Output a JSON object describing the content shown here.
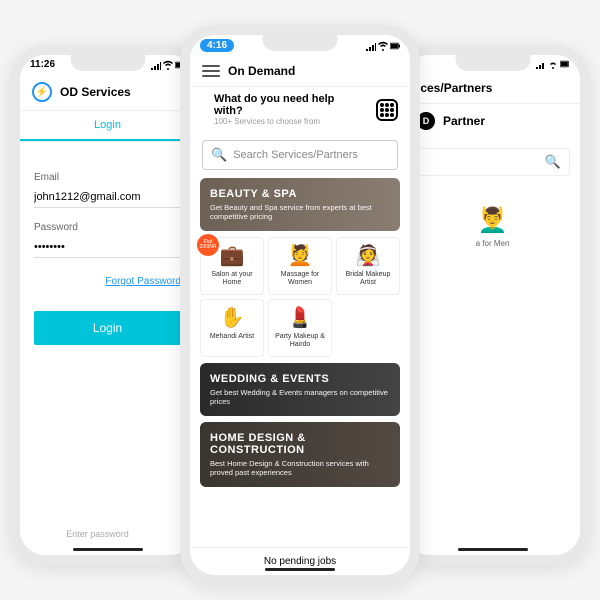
{
  "phoneLeft": {
    "time": "11:26",
    "appName": "OD Services",
    "tabs": {
      "login": "Login"
    },
    "email": {
      "label": "Email",
      "value": "john1212@gmail.com"
    },
    "password": {
      "label": "Password",
      "value": "••••••••"
    },
    "forgot": "Forgot Password",
    "loginBtn": "Login",
    "hint": "Enter password"
  },
  "phoneCenter": {
    "time": "4:16",
    "title": "On Demand",
    "subtitle": "What do you need help with?",
    "subtext": "100+ Services to choose from",
    "searchPlaceholder": "Search Services/Partners",
    "banners": {
      "beauty": {
        "title": "BEAUTY & SPA",
        "desc": "Get Beauty and Spa service from experts at best competitive pricing"
      },
      "wedding": {
        "title": "WEDDING & EVENTS",
        "desc": "Get best Wedding & Events managers on competitive prices"
      },
      "home": {
        "title": "HOME DESIGN & CONSTRUCTION",
        "desc": "Best Home Design & Construction services with proved past experiences"
      }
    },
    "badge": "Flat 200INR",
    "services": [
      {
        "label": "Salon at your Home",
        "icon": "💼"
      },
      {
        "label": "Massage for Women",
        "icon": "💆"
      },
      {
        "label": "Bridal Makeup Artist",
        "icon": "👰"
      },
      {
        "label": "Mehandi Artist",
        "icon": "✋"
      },
      {
        "label": "Party Makeup & Hairdo",
        "icon": "💄"
      }
    ],
    "bottomBar": "No pending jobs"
  },
  "phoneRight": {
    "headerPartial": "ices/Partners",
    "partnerLabel": "Partner",
    "service": {
      "label": "a for Men",
      "icon": "💆‍♂️"
    }
  }
}
